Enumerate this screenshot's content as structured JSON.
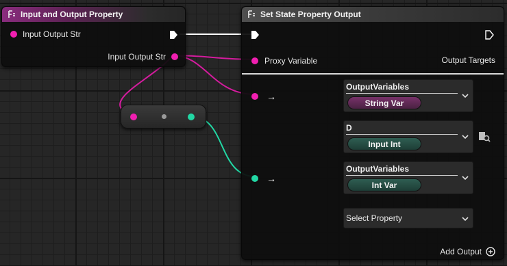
{
  "input_node": {
    "title": "Input and Output Property",
    "input_pin_label": "Input Output Str",
    "output_pin_label": "Input Output Str"
  },
  "set_node": {
    "title": "Set State Property Output",
    "proxy_label": "Proxy Variable",
    "output_targets_label": "Output Targets",
    "arrow": "→",
    "entries": [
      {
        "title": "OutputVariables",
        "value": "String Var"
      },
      {
        "title": "D",
        "value": "Input Int"
      },
      {
        "title": "OutputVariables",
        "value": "Int Var"
      }
    ],
    "select_label": "Select Property",
    "add_output_label": "Add Output"
  },
  "colors": {
    "string_pin": "#f01fb0",
    "int_pin": "#22d7a4",
    "exec_wire": "#ffffff"
  }
}
